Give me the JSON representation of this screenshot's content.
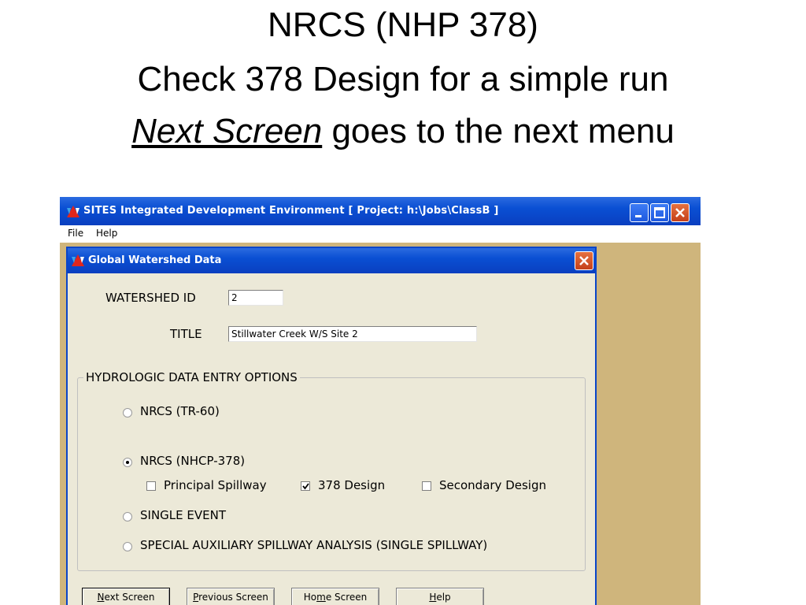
{
  "slide": {
    "line1": "NRCS (NHP 378)",
    "line2": "Check 378 Design for a simple run",
    "line3_emphasis": "Next Screen",
    "line3_rest": " goes to the next menu"
  },
  "app": {
    "title": "SITES Integrated Development Environment [ Project: h:\\Jobs\\ClassB ]",
    "menu": [
      "File",
      "Help"
    ]
  },
  "dialog": {
    "title": "Global Watershed Data",
    "watershed_id_label": "WATERSHED ID",
    "watershed_id_value": "2",
    "title_label": "TITLE",
    "title_value": "Stillwater Creek W/S Site 2",
    "group_label": "HYDROLOGIC DATA ENTRY OPTIONS",
    "options": {
      "tr60": "NRCS (TR-60)",
      "nhcp378": "NRCS (NHCP-378)",
      "single_event": "SINGLE EVENT",
      "special": "SPECIAL AUXILIARY SPILLWAY ANALYSIS (SINGLE SPILLWAY)"
    },
    "selected_option": "NRCS (NHCP-378)",
    "checkboxes": {
      "principal": {
        "label": "Principal Spillway",
        "checked": false
      },
      "design378": {
        "label": "378 Design",
        "checked": true
      },
      "secondary": {
        "label": "Secondary Design",
        "checked": false
      }
    },
    "buttons": {
      "next": {
        "mnemonic": "N",
        "rest": "ext Screen"
      },
      "previous": {
        "mnemonic": "P",
        "rest": "revious Screen"
      },
      "home": {
        "pre": "Ho",
        "mnemonic": "m",
        "rest": "e Screen"
      },
      "help": {
        "mnemonic": "H",
        "rest": "elp"
      }
    }
  },
  "colors": {
    "titlebar": "#0a4fd3",
    "dialog_bg": "#ece9d8",
    "workspace": "#cfb57c",
    "close_button": "#c5401a"
  },
  "icons": [
    "sites-app-icon",
    "minimize-icon",
    "maximize-icon",
    "close-icon",
    "checkmark-icon"
  ]
}
